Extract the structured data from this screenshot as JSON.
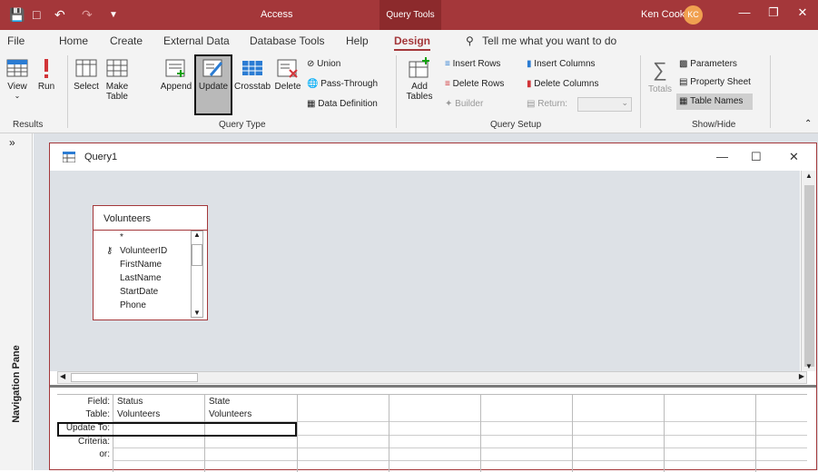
{
  "titlebar": {
    "app": "Access",
    "context_tab": "Query Tools",
    "user": "Ken Cook",
    "initials": "KC"
  },
  "tabs": {
    "file": "File",
    "home": "Home",
    "create": "Create",
    "external_data": "External Data",
    "database_tools": "Database Tools",
    "help": "Help",
    "design": "Design",
    "tell_me": "Tell me what you want to do"
  },
  "ribbon": {
    "results": {
      "view": "View",
      "run": "Run",
      "label": "Results"
    },
    "query_type": {
      "select": "Select",
      "make_table_1": "Make",
      "make_table_2": "Table",
      "append": "Append",
      "update": "Update",
      "crosstab": "Crosstab",
      "delete": "Delete",
      "union": "Union",
      "pass_through": "Pass-Through",
      "data_definition": "Data Definition",
      "label": "Query Type"
    },
    "query_setup": {
      "add_tables_1": "Add",
      "add_tables_2": "Tables",
      "insert_rows": "Insert Rows",
      "delete_rows": "Delete Rows",
      "builder": "Builder",
      "insert_columns": "Insert Columns",
      "delete_columns": "Delete Columns",
      "return": "Return:",
      "label": "Query Setup"
    },
    "show_hide": {
      "totals": "Totals",
      "parameters": "Parameters",
      "property_sheet": "Property Sheet",
      "table_names": "Table Names",
      "label": "Show/Hide"
    }
  },
  "nav_pane": {
    "label": "Navigation Pane"
  },
  "query": {
    "title": "Query1",
    "field_list": {
      "table": "Volunteers",
      "fields": [
        "*",
        "VolunteerID",
        "FirstName",
        "LastName",
        "StartDate",
        "Phone"
      ]
    },
    "grid": {
      "row_labels": [
        "Field:",
        "Table:",
        "Update To:",
        "Criteria:",
        "or:"
      ],
      "columns": [
        {
          "field": "Status",
          "table": "Volunteers"
        },
        {
          "field": "State",
          "table": "Volunteers"
        }
      ]
    }
  }
}
